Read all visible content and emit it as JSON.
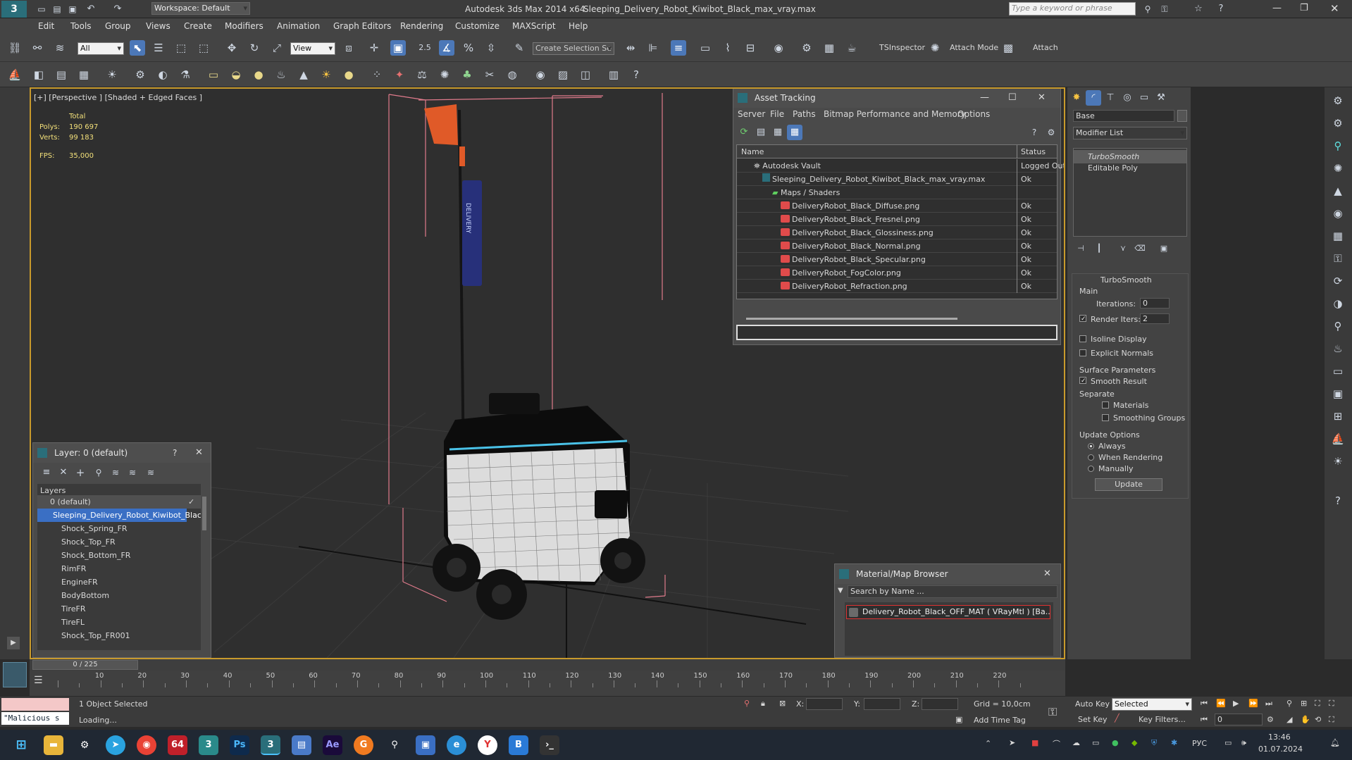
{
  "title_bar": {
    "workspace": "Workspace: Default",
    "app": "Autodesk 3ds Max  2014 x64",
    "file": "Sleeping_Delivery_Robot_Kiwibot_Black_max_vray.max",
    "search_placeholder": "Type a keyword or phrase"
  },
  "menu": [
    "Edit",
    "Tools",
    "Group",
    "Views",
    "Create",
    "Modifiers",
    "Animation",
    "Graph Editors",
    "Rendering",
    "Customize",
    "MAXScript",
    "Help"
  ],
  "toolbar": {
    "selection_filter": "All",
    "ref_coord": "View",
    "create_selection_set": "Create Selection Se",
    "snap_value": "2.5",
    "tsinspector": "TSInspector",
    "attach_mode": "Attach Mode",
    "attach": "Attach"
  },
  "viewport": {
    "label": "[+] [Perspective ] [Shaded + Edged Faces ]",
    "stats_header": "Total",
    "polys_label": "Polys:",
    "polys_value": "190 697",
    "verts_label": "Verts:",
    "verts_value": "99 183",
    "fps_label": "FPS:",
    "fps_value": "35,000",
    "flag_text": "DELIVERY"
  },
  "asset_tracking": {
    "title": "Asset Tracking",
    "menu": [
      "Server",
      "File",
      "Paths",
      "Bitmap Performance and Memory",
      "Options"
    ],
    "col_name": "Name",
    "col_status": "Status",
    "rows": [
      {
        "name": "Autodesk Vault",
        "status": "Logged Out"
      },
      {
        "name": "Sleeping_Delivery_Robot_Kiwibot_Black_max_vray.max",
        "status": "Ok"
      },
      {
        "name": "Maps / Shaders",
        "status": ""
      },
      {
        "name": "DeliveryRobot_Black_Diffuse.png",
        "status": "Ok"
      },
      {
        "name": "DeliveryRobot_Black_Fresnel.png",
        "status": "Ok"
      },
      {
        "name": "DeliveryRobot_Black_Glossiness.png",
        "status": "Ok"
      },
      {
        "name": "DeliveryRobot_Black_Normal.png",
        "status": "Ok"
      },
      {
        "name": "DeliveryRobot_Black_Specular.png",
        "status": "Ok"
      },
      {
        "name": "DeliveryRobot_FogColor.png",
        "status": "Ok"
      },
      {
        "name": "DeliveryRobot_Refraction.png",
        "status": "Ok"
      }
    ]
  },
  "layer_explorer": {
    "title": "Layer: 0 (default)",
    "help": "?",
    "header": "Layers",
    "items": [
      "0 (default)",
      "Sleeping_Delivery_Robot_Kiwibot_Black",
      "Shock_Spring_FR",
      "Shock_Top_FR",
      "Shock_Bottom_FR",
      "RimFR",
      "EngineFR",
      "BodyBottom",
      "TireFR",
      "TireFL",
      "Shock_Top_FR001"
    ]
  },
  "material_browser": {
    "title": "Material/Map Browser",
    "search_placeholder": "Search by Name ...",
    "item": "Delivery_Robot_Black_OFF_MAT  ( VRayMtl )  [Ba..."
  },
  "command_panel": {
    "object_name": "Base",
    "modifier_list": "Modifier List",
    "stack": [
      "TurboSmooth",
      "Editable Poly"
    ],
    "rollout_title": "TurboSmooth",
    "main_group": "Main",
    "iterations_label": "Iterations:",
    "iterations_value": "0",
    "render_iters_label": "Render Iters:",
    "render_iters_value": "2",
    "isoline": "Isoline Display",
    "explicit_normals": "Explicit Normals",
    "surface_params": "Surface Parameters",
    "smooth_result": "Smooth Result",
    "separate": "Separate",
    "materials": "Materials",
    "smoothing_groups": "Smoothing Groups",
    "update_options": "Update Options",
    "always": "Always",
    "when_rendering": "When Rendering",
    "manually": "Manually",
    "update_button": "Update"
  },
  "timeline": {
    "frame": "0 / 225",
    "ticks": [
      "10",
      "20",
      "30",
      "40",
      "50",
      "60",
      "70",
      "80",
      "90",
      "100",
      "110",
      "120",
      "130",
      "140",
      "150",
      "160",
      "170",
      "180",
      "190",
      "200",
      "210",
      "220"
    ]
  },
  "status": {
    "maxscript": "\"Malicious s",
    "selected": "1 Object Selected",
    "loading": "Loading...",
    "x_label": "X:",
    "y_label": "Y:",
    "z_label": "Z:",
    "grid": "Grid = 10,0cm",
    "add_time_tag": "Add Time Tag",
    "auto_key": "Auto Key",
    "set_key": "Set Key",
    "key_mode": "Selected",
    "key_filters": "Key Filters...",
    "frame_field": "0"
  },
  "taskbar": {
    "lang": "РУС",
    "time": "13:46",
    "date": "01.07.2024"
  }
}
